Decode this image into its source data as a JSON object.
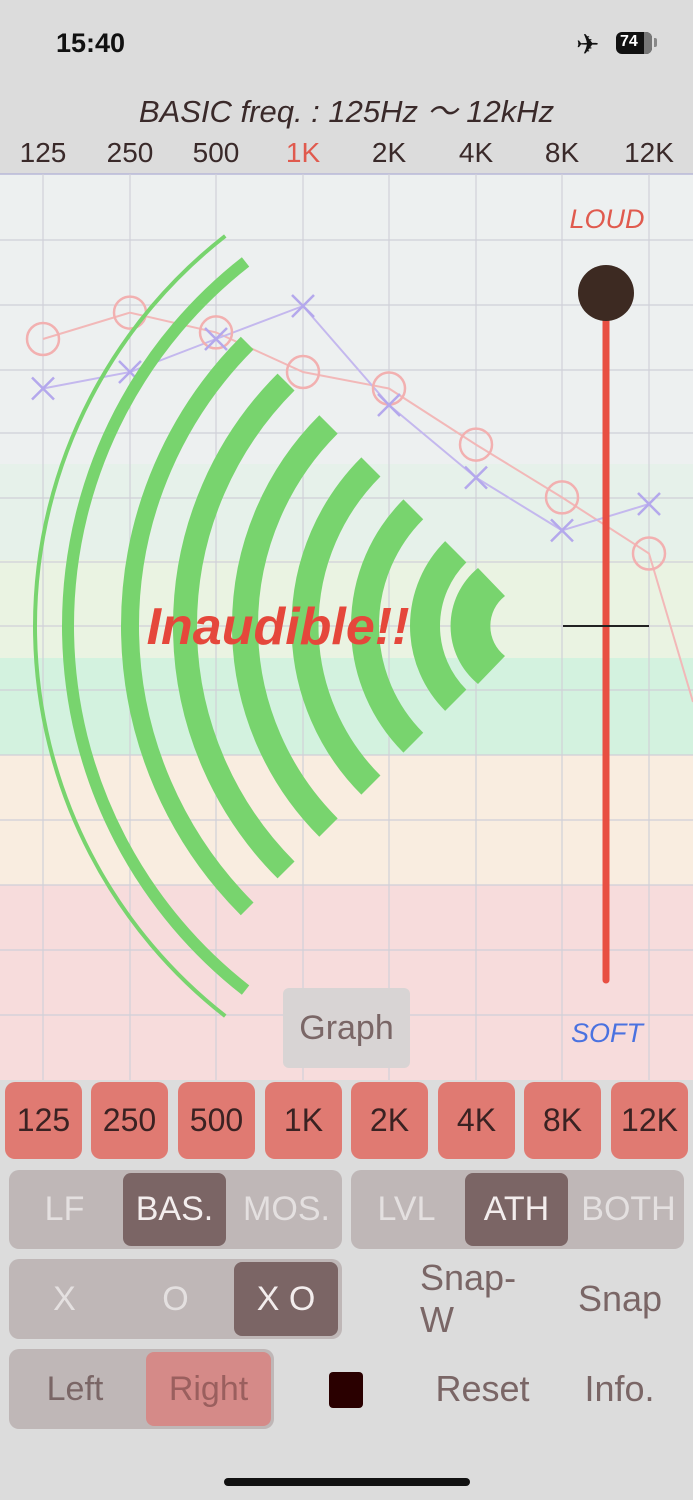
{
  "status_bar": {
    "time": "15:40",
    "battery": "74"
  },
  "header": {
    "title": "BASIC freq. : 125Hz 〜 12kHz"
  },
  "axis": {
    "labels": [
      "125",
      "250",
      "500",
      "1K",
      "2K",
      "4K",
      "8K",
      "12K"
    ],
    "active_index": 3,
    "active_color": "#e05a4e"
  },
  "graph": {
    "loud_label": "LOUD",
    "soft_label": "SOFT",
    "message": "Inaudible!!",
    "slider_level": 0.0,
    "series_o": [
      30,
      22,
      28,
      40,
      45,
      62,
      78,
      95,
      140
    ],
    "series_x": [
      45,
      40,
      30,
      20,
      50,
      72,
      88,
      80
    ],
    "wave_color": "#78d46e",
    "slider_color": "#e84f42"
  },
  "graph_button": {
    "label": "Graph"
  },
  "freq_buttons": [
    "125",
    "250",
    "500",
    "1K",
    "2K",
    "4K",
    "8K",
    "12K"
  ],
  "mode_seg": {
    "items": [
      "LF",
      "BAS.",
      "MOS."
    ],
    "selected": "BAS."
  },
  "type_seg": {
    "items": [
      "LVL",
      "ATH",
      "BOTH"
    ],
    "selected": "ATH"
  },
  "mark_seg": {
    "items": [
      "X",
      "O",
      "X O"
    ],
    "selected": "X O"
  },
  "ear_seg": {
    "items": [
      "Left",
      "Right"
    ],
    "selected": "Right"
  },
  "actions": {
    "snap_w": "Snap-W",
    "snap": "Snap",
    "reset": "Reset",
    "info": "Info."
  },
  "colors": {
    "accent": "#e07a72",
    "swatch": "#2a0000"
  }
}
